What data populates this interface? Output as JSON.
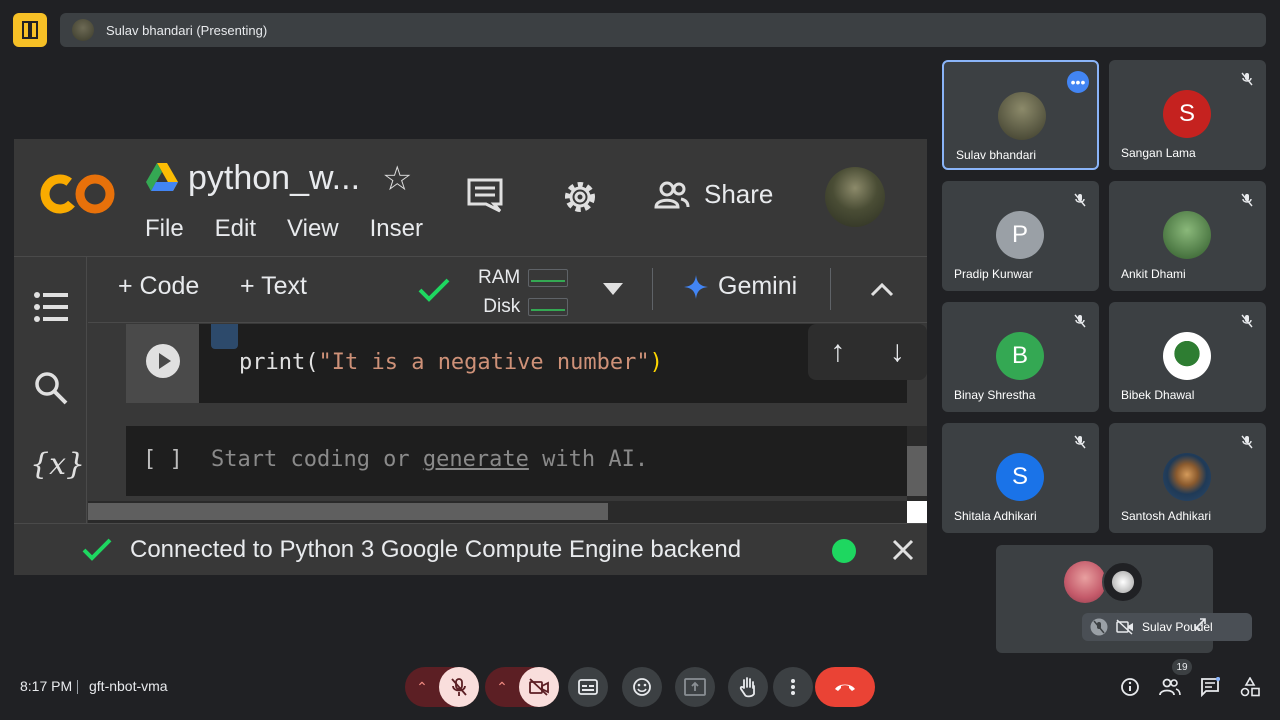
{
  "meeting": {
    "presenter_title": "Sulav bhandari (Presenting)",
    "time": "8:17 PM",
    "meeting_code": "gft-nbot-vma",
    "participant_count": "19"
  },
  "colab": {
    "doc_name": "python_w...",
    "menu": [
      "File",
      "Edit",
      "View",
      "Inser"
    ],
    "share_label": "Share",
    "add_code": "+ Code",
    "add_text": "+ Text",
    "ram_label": "RAM",
    "disk_label": "Disk",
    "gemini_label": "Gemini",
    "cell1_code_fn": "print(",
    "cell1_code_str": "\"It is a negative number\"",
    "cell1_code_end": ")",
    "cell2_bracket": "[ ]",
    "cell2_hint_a": "Start coding or ",
    "cell2_hint_link": "generate",
    "cell2_hint_b": " with AI.",
    "status_message": "Connected to Python 3 Google Compute Engine backend"
  },
  "participants": [
    {
      "name": "Sulav bhandari",
      "initial": "",
      "color": "#6d6a55",
      "active": true
    },
    {
      "name": "Sangan Lama",
      "initial": "S",
      "color": "#c5221f"
    },
    {
      "name": "Pradip Kunwar",
      "initial": "P",
      "color": "#9aa0a6"
    },
    {
      "name": "Ankit Dhami",
      "initial": "",
      "color": "#3f6b3a"
    },
    {
      "name": "Binay Shrestha",
      "initial": "B",
      "color": "#34a853"
    },
    {
      "name": "Bibek Dhawal",
      "initial": "",
      "color": "#ffffff"
    },
    {
      "name": "Shitala Adhikari",
      "initial": "S",
      "color": "#1a73e8"
    },
    {
      "name": "Santosh Adhikari",
      "initial": "",
      "color": "#2d4a6b"
    }
  ],
  "pinned_participant": {
    "name": "Sulav Poudel"
  }
}
